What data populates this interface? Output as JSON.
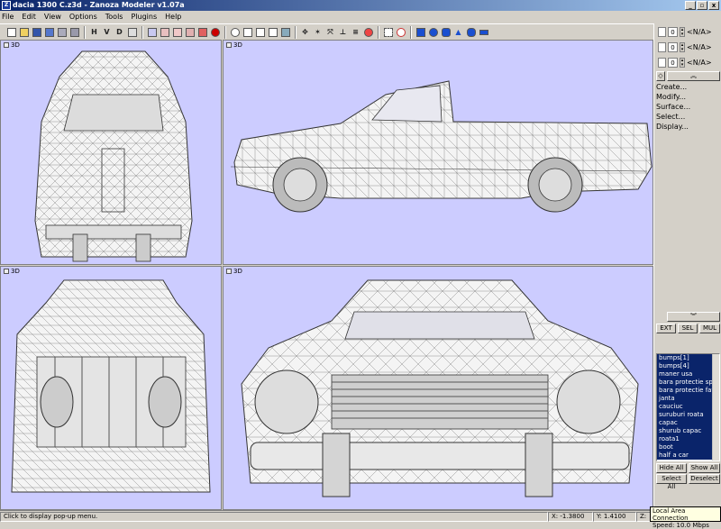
{
  "window": {
    "title": "dacia 1300 C.z3d - Zanoza Modeler v1.07a",
    "app_icon": "Z",
    "min": "_",
    "max": "▫",
    "close": "x"
  },
  "menu": [
    "File",
    "Edit",
    "View",
    "Options",
    "Tools",
    "Plugins",
    "Help"
  ],
  "toolbar": {
    "h": "H",
    "v": "V",
    "d": "D"
  },
  "viewports": {
    "top_left": "3D",
    "top_right": "3D",
    "bottom_left": "3D",
    "bottom_right": "3D"
  },
  "panel": {
    "selectors": [
      {
        "num": "0",
        "value": "<N/A>"
      },
      {
        "num": "0",
        "value": "<N/A>"
      },
      {
        "num": "0",
        "value": "<N/A>"
      }
    ],
    "commands": [
      "Create...",
      "Modify...",
      "Surface...",
      "Select...",
      "Display..."
    ],
    "mode_buttons": [
      "EXT",
      "SEL",
      "MUL"
    ],
    "objects": [
      "bumps[1]",
      "bumps[4]",
      "maner usa",
      "bara protectie sps",
      "bara protectie fat",
      "janta",
      "cauciuc",
      "suruburi roata",
      "capac",
      "shurub capac",
      "roata1",
      "boot",
      "half a car"
    ],
    "hide_all": "Hide All",
    "show_all": "Show All",
    "select_all": "Select All",
    "deselect": "Deselect"
  },
  "status": {
    "hint": "Click to display pop-up menu.",
    "x": "X: -1.3800",
    "y": "Y: 1.4100",
    "z": "Z:"
  },
  "tooltip": {
    "line1": "Local Area Connection",
    "line2": "Speed: 10.0 Mbps"
  }
}
